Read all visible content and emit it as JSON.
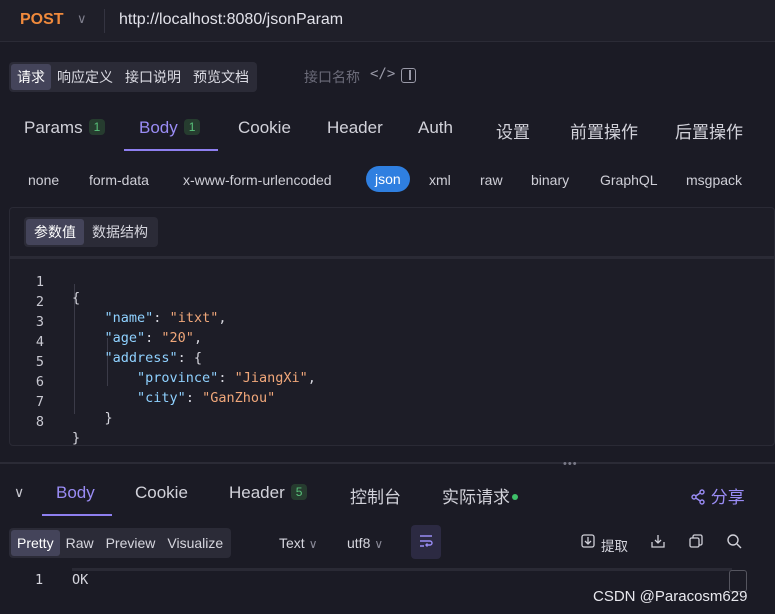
{
  "request": {
    "method": "POST",
    "method_caret": "∨",
    "url": "http://localhost:8080/jsonParam",
    "sub_tabs": [
      "请求",
      "响应定义",
      "接口说明",
      "预览文档"
    ],
    "api_name_placeholder": "接口名称",
    "code_icon": "</>"
  },
  "main_tabs": [
    {
      "label": "Params",
      "badge": "1"
    },
    {
      "label": "Body",
      "badge": "1"
    },
    {
      "label": "Cookie"
    },
    {
      "label": "Header"
    },
    {
      "label": "Auth"
    },
    {
      "label": "设置"
    },
    {
      "label": "前置操作"
    },
    {
      "label": "后置操作"
    }
  ],
  "body_types": [
    "none",
    "form-data",
    "x-www-form-urlencoded",
    "json",
    "xml",
    "raw",
    "binary",
    "GraphQL",
    "msgpack"
  ],
  "editor": {
    "segments": [
      "参数值",
      "数据结构"
    ],
    "line_numbers": [
      "1",
      "2",
      "3",
      "4",
      "5",
      "6",
      "7",
      "8"
    ],
    "tokens": {
      "open_brace": "{",
      "k_name": "\"name\"",
      "v_name": "\"itxt\"",
      "k_age": "\"age\"",
      "v_age": "\"20\"",
      "k_address": "\"address\"",
      "k_province": "\"province\"",
      "v_province": "\"JiangXi\"",
      "k_city": "\"city\"",
      "v_city": "\"GanZhou\"",
      "close_inner": "}",
      "close_outer": "}"
    }
  },
  "response": {
    "collapse_icon": "∨",
    "tabs": [
      {
        "label": "Body"
      },
      {
        "label": "Cookie"
      },
      {
        "label": "Header",
        "badge": "5"
      },
      {
        "label": "控制台"
      },
      {
        "label": "实际请求"
      }
    ],
    "share_label": "分享",
    "views": [
      "Pretty",
      "Raw",
      "Preview",
      "Visualize"
    ],
    "format": "Text",
    "encoding": "utf8",
    "extract_label": "提取",
    "line_number": "1",
    "body_text": "OK"
  },
  "watermark": "CSDN @Paracosm629",
  "colors": {
    "accent": "#8e7ff0",
    "method": "#f08a3c",
    "json_active": "#2f7fe0",
    "badge_green": "#58c07a"
  }
}
